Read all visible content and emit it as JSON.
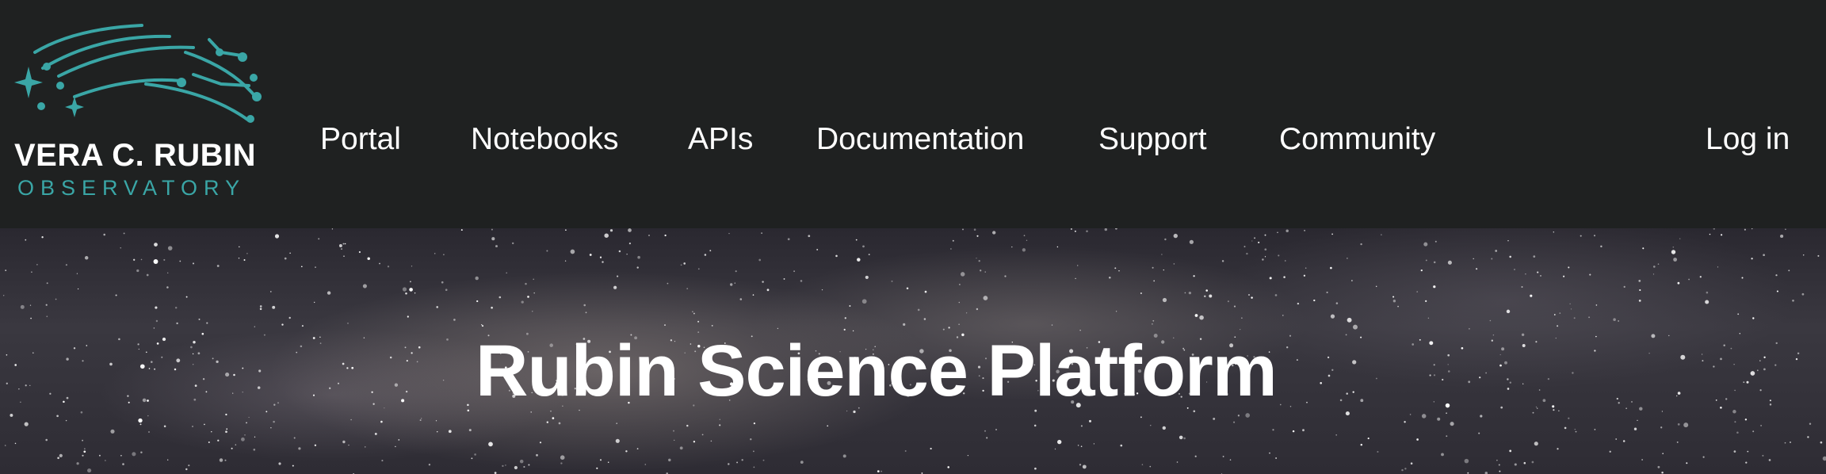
{
  "logo": {
    "name": "VERA C. RUBIN",
    "subtitle": "OBSERVATORY"
  },
  "nav": {
    "items": [
      {
        "label": "Portal"
      },
      {
        "label": "Notebooks"
      },
      {
        "label": "APIs"
      },
      {
        "label": "Documentation"
      },
      {
        "label": "Support"
      },
      {
        "label": "Community"
      }
    ],
    "login_label": "Log in"
  },
  "hero": {
    "title": "Rubin Science Platform"
  },
  "colors": {
    "header_bg": "#1f2121",
    "brand_teal": "#3aa6a6",
    "text": "#ffffff"
  }
}
